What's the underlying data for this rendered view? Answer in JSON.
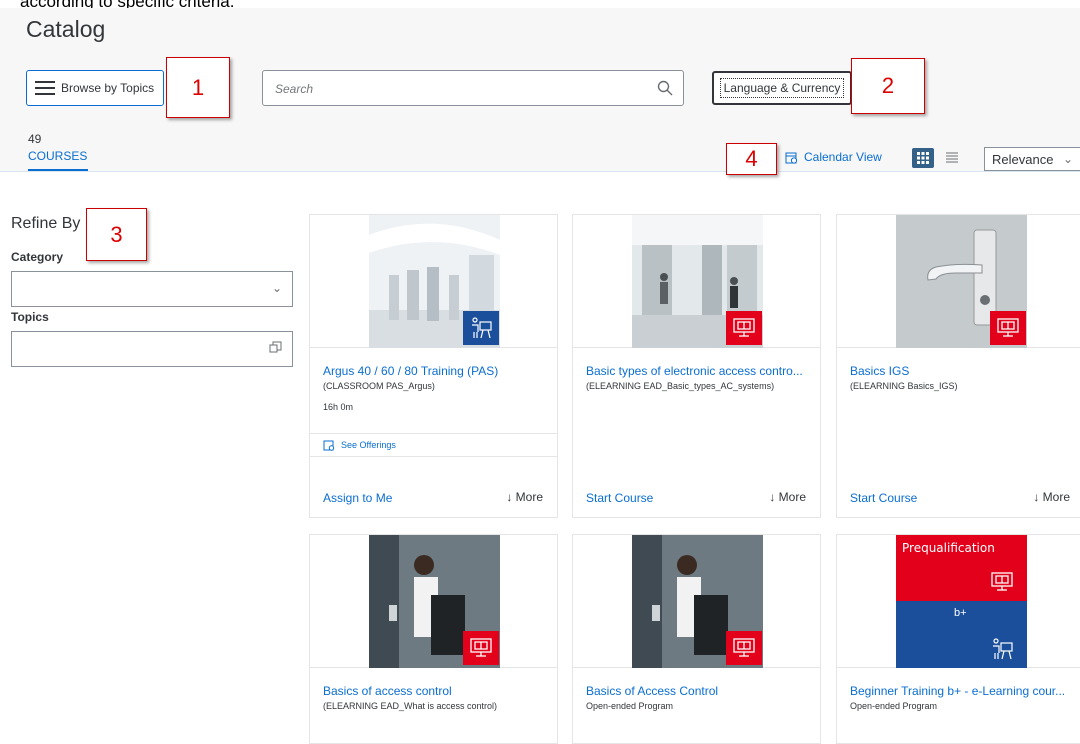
{
  "top_caption": "according to specific criteria.",
  "page_title": "Catalog",
  "browse_label": "Browse by Topics",
  "search_placeholder": "Search",
  "language_label": "Language & Currency",
  "result_count": "49",
  "tab_label": "COURSES",
  "calendar_label": "Calendar View",
  "sort_value": "Relevance",
  "annotations": [
    "1",
    "2",
    "3",
    "4"
  ],
  "refine": {
    "title": "Refine By",
    "category_label": "Category",
    "topics_label": "Topics"
  },
  "cards": [
    {
      "title": "Argus 40 / 60 / 80 Training (PAS)",
      "subtitle": "(CLASSROOM PAS_Argus)",
      "duration": "16h 0m",
      "offerings": "See Offerings",
      "action": "Assign to Me",
      "more": "More",
      "type": "classroom"
    },
    {
      "title": "Basic types of electronic access contro...",
      "subtitle": "(ELEARNING EAD_Basic_types_AC_systems)",
      "action": "Start Course",
      "more": "More",
      "type": "elearning"
    },
    {
      "title": "Basics IGS",
      "subtitle": "(ELEARNING Basics_IGS)",
      "action": "Start Course",
      "more": "More",
      "type": "elearning"
    },
    {
      "title": "Basics of access control",
      "subtitle": "(ELEARNING EAD_What is access control)",
      "type": "elearning"
    },
    {
      "title": "Basics of Access Control",
      "subtitle": "Open-ended Program",
      "type": "elearning"
    },
    {
      "title": "Beginner Training b+ - e-Learning cour...",
      "subtitle": "Open-ended Program",
      "image_text_top": "Prequalification",
      "image_text_bottom": "b+",
      "type": "program"
    }
  ],
  "colors": {
    "accent": "#0a6ed1",
    "brand_red": "#e2001a",
    "brand_blue": "#1b4f9b",
    "annotation_red": "#dd0000"
  }
}
